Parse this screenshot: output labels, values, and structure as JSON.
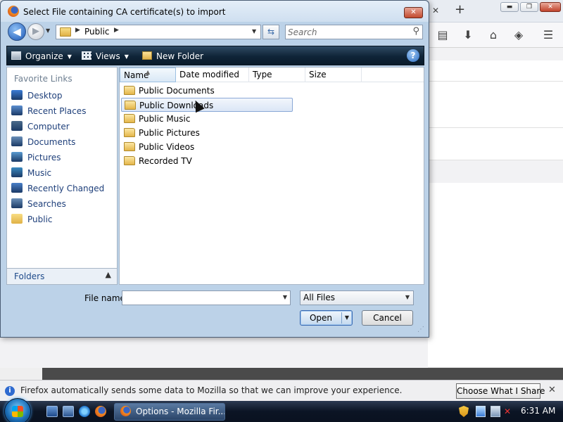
{
  "dialog": {
    "title": "Select File containing CA certificate(s) to import",
    "close_label": "✕",
    "address": {
      "current_folder": "Public"
    },
    "search": {
      "placeholder": "Search"
    },
    "commands": {
      "organize": "Organize",
      "views": "Views",
      "new_folder": "New Folder",
      "help": "?"
    },
    "favorites": {
      "heading": "Favorite Links",
      "items": [
        {
          "label": "Desktop",
          "icon": "desktop-icon",
          "color": "#3a7bd5"
        },
        {
          "label": "Recent Places",
          "icon": "recent-places-icon",
          "color": "#5b8ed0"
        },
        {
          "label": "Computer",
          "icon": "computer-icon",
          "color": "#4a6a8a"
        },
        {
          "label": "Documents",
          "icon": "documents-icon",
          "color": "#6a8fb8"
        },
        {
          "label": "Pictures",
          "icon": "pictures-icon",
          "color": "#5a9ad0"
        },
        {
          "label": "Music",
          "icon": "music-icon",
          "color": "#3a8ac0"
        },
        {
          "label": "Recently Changed",
          "icon": "recently-changed-icon",
          "color": "#4a80c8"
        },
        {
          "label": "Searches",
          "icon": "searches-icon",
          "color": "#6a8fb8"
        },
        {
          "label": "Public",
          "icon": "public-folder-icon",
          "color": "#e0b146"
        }
      ],
      "folders_label": "Folders"
    },
    "columns": [
      "Name",
      "Date modified",
      "Type",
      "Size"
    ],
    "files": [
      {
        "name": "Public Documents",
        "selected": false
      },
      {
        "name": "Public Downloads",
        "selected": true
      },
      {
        "name": "Public Music",
        "selected": false
      },
      {
        "name": "Public Pictures",
        "selected": false
      },
      {
        "name": "Public Videos",
        "selected": false
      },
      {
        "name": "Recorded TV",
        "selected": false
      }
    ],
    "filename": {
      "label": "File name:",
      "value": ""
    },
    "filetype": {
      "value": "All Files"
    },
    "buttons": {
      "open": "Open",
      "cancel": "Cancel"
    }
  },
  "firefox": {
    "notification": {
      "text": "Firefox automatically sends some data to Mozilla so that we can improve your experience.",
      "button": "Choose What I Share",
      "close": "✕"
    },
    "window_controls": {
      "minimize": "▬",
      "restore": "❐",
      "close": "✕"
    },
    "new_tab": "+",
    "tab_close": "✕"
  },
  "taskbar": {
    "window_button": "Options - Mozilla Fir...",
    "clock": "6:31 AM"
  },
  "colors": {
    "command_bar": "#0f2437",
    "selection_border": "#8aa8d6",
    "link_text": "#1e3f7a"
  }
}
